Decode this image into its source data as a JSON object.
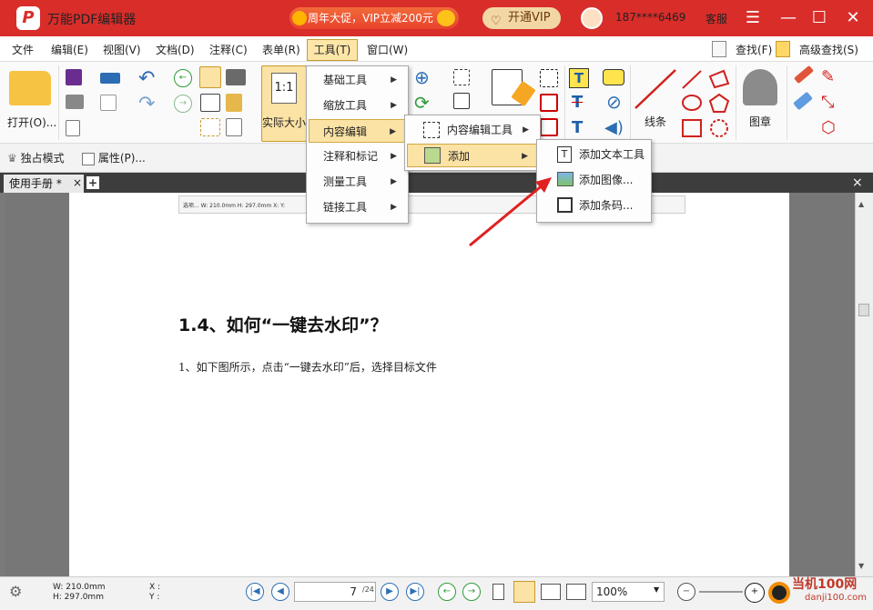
{
  "titlebar": {
    "app_title": "万能PDF编辑器",
    "promo_text": "周年大促，VIP立减200元",
    "vip_button": "开通VIP",
    "user_phone": "187****6469",
    "service": "客服",
    "menu_icon": "hamburger-icon",
    "minimize": "minimize-icon",
    "maximize": "maximize-icon",
    "close": "close-icon",
    "brand_color": "#d92d2a"
  },
  "menubar": {
    "items": [
      "文件",
      "编辑(E)",
      "视图(V)",
      "文档(D)",
      "注释(C)",
      "表单(R)",
      "工具(T)",
      "窗口(W)"
    ],
    "find": "查找(F)",
    "advanced_find": "高级查找(S)"
  },
  "ribbon": {
    "open_label": "打开(O)...",
    "actual_size_label": "实际大小",
    "actual_size_icon_text": "1:1",
    "lines_label": "线条",
    "stamp_label": "图章"
  },
  "subbar": {
    "exclusive_mode": "独占模式",
    "properties": "属性(P)..."
  },
  "tabs": {
    "doc_tab": "使用手册 *",
    "tab_close": "×",
    "tab_add": "+",
    "pane_close": "×"
  },
  "menu_tools": {
    "items": [
      "基础工具",
      "缩放工具",
      "内容编辑",
      "注释和标记",
      "测量工具",
      "链接工具"
    ]
  },
  "menu_content_edit": {
    "items": [
      "内容编辑工具",
      "添加"
    ]
  },
  "menu_add": {
    "items": [
      "添加文本工具",
      "添加图像...",
      "添加条码..."
    ]
  },
  "document": {
    "heading": "1.4、如何“一键去水印”？",
    "body": "1、如下图所示，点击“一键去水印”后，选择目标文件",
    "mini_toolbar_text": "选项... W: 210.0mm H: 297.0mm X: Y:"
  },
  "statusbar": {
    "width": "W: 210.0mm",
    "height": "H: 297.0mm",
    "x": "X :",
    "y": "Y :",
    "current_page": "7",
    "total_pages": "/24",
    "zoom": "100%"
  },
  "watermark": {
    "line1": "当机100网",
    "line2": "danji100.com"
  }
}
